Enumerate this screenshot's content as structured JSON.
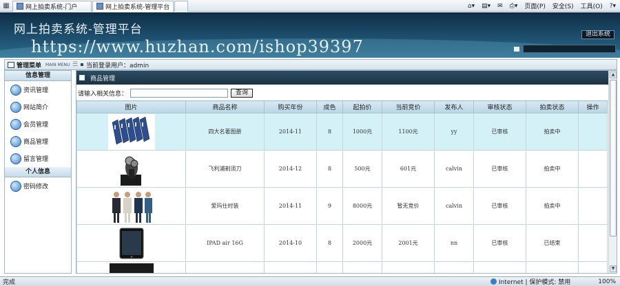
{
  "browser": {
    "tabs": [
      {
        "label": "网上拍卖系统-门户"
      },
      {
        "label": "网上拍卖系统-管理平台"
      }
    ],
    "tools": {
      "page": "页面(P)",
      "safety": "安全(S)",
      "tools": "工具(O)"
    },
    "status": {
      "left": "完成",
      "zone": "Internet | 保护模式: 禁用",
      "zoom": "100%"
    }
  },
  "header": {
    "title": "网上拍卖系统-管理平台",
    "logout": "退出系统",
    "watermark": "https://www.huzhan.com/ishop39397"
  },
  "statusbar": {
    "menu_title": "管理菜单",
    "menu_sub": "MAIN MENU",
    "current_user": "当前登录用户：admin"
  },
  "sidebar": {
    "sections": [
      {
        "title": "信息管理",
        "items": [
          {
            "label": "资讯管理",
            "icon": "globe-icon"
          },
          {
            "label": "网站简介",
            "icon": "globe-icon"
          },
          {
            "label": "会员管理",
            "icon": "globe-icon"
          },
          {
            "label": "商品管理",
            "icon": "globe-icon"
          },
          {
            "label": "留言管理",
            "icon": "globe-icon"
          }
        ]
      },
      {
        "title": "个人信息",
        "items": [
          {
            "label": "密码修改",
            "icon": "globe-icon"
          }
        ]
      }
    ]
  },
  "main": {
    "title": "商品管理",
    "search_label": "请输入相关信息：",
    "search_value": "",
    "search_button": "查询",
    "columns": [
      "图片",
      "商品名称",
      "购买年份",
      "成色",
      "起拍价",
      "当前竞价",
      "发布人",
      "审核状态",
      "拍卖状态",
      "操作"
    ],
    "rows": [
      {
        "image": "book-set-image",
        "name": "四大名著图册",
        "year": "2014-11",
        "condition": "8",
        "start_price": "1000元",
        "current_bid": "1100元",
        "publisher": "yy",
        "review": "已审核",
        "auction": "拍卖中",
        "action": ""
      },
      {
        "image": "shaver-image",
        "name": "飞利浦剃须刀",
        "year": "2014-12",
        "condition": "8",
        "start_price": "500元",
        "current_bid": "601元",
        "publisher": "calvin",
        "review": "已审核",
        "auction": "拍卖中",
        "action": ""
      },
      {
        "image": "clothing-image",
        "name": "爱玛仕时装",
        "year": "2014-11",
        "condition": "9",
        "start_price": "8000元",
        "current_bid": "暂无竞价",
        "publisher": "calvin",
        "review": "已审核",
        "auction": "拍卖中",
        "action": ""
      },
      {
        "image": "ipad-image",
        "name": "IPAD air 16G",
        "year": "2014-10",
        "condition": "8",
        "start_price": "2000元",
        "current_bid": "2001元",
        "publisher": "nn",
        "review": "已审核",
        "auction": "已结束",
        "action": ""
      }
    ]
  },
  "colors": {
    "header_dark": "#0f2e45",
    "header_light": "#2b6b8a",
    "row_highlight": "#d4f1f8",
    "grid_header": "#b9d5e4"
  }
}
